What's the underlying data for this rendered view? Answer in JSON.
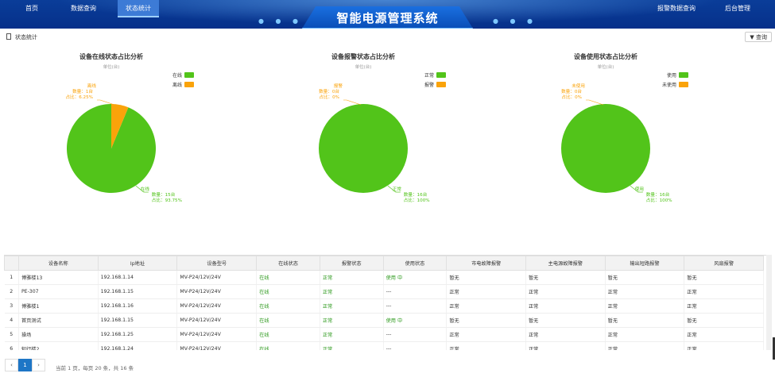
{
  "header": {
    "nav_left": [
      "首页",
      "数据查询",
      "状态统计"
    ],
    "nav_right": [
      "报警数据查询",
      "后台管理"
    ],
    "title": "智能电源管理系统",
    "dots": "● ● ●"
  },
  "subheader": {
    "label": "状态统计",
    "query_button": "▼ 查询"
  },
  "chart_data": [
    {
      "type": "pie",
      "title": "设备在线状态占比分析",
      "subtitle": "单位(台)",
      "legend": [
        "在线",
        "离线"
      ],
      "colors": [
        "#52c41a",
        "#faa30a"
      ],
      "slices": [
        {
          "name": "在线",
          "value": 15,
          "percent": "93.75%",
          "label_lines": [
            "在线",
            "数量：15台",
            "占比：93.75%"
          ]
        },
        {
          "name": "离线",
          "value": 1,
          "percent": "6.25%",
          "label_lines": [
            "离线",
            "数量：1台",
            "占比：6.25%"
          ]
        }
      ]
    },
    {
      "type": "pie",
      "title": "设备报警状态占比分析",
      "subtitle": "单位(台)",
      "legend": [
        "正常",
        "报警"
      ],
      "colors": [
        "#52c41a",
        "#faa30a"
      ],
      "slices": [
        {
          "name": "正常",
          "value": 16,
          "percent": "100%",
          "label_lines": [
            "正常",
            "数量：16台",
            "占比：100%"
          ]
        },
        {
          "name": "报警",
          "value": 0,
          "percent": "0%",
          "label_lines": [
            "报警",
            "数量：0台",
            "占比：0%"
          ]
        }
      ]
    },
    {
      "type": "pie",
      "title": "设备使用状态占比分析",
      "subtitle": "单位(台)",
      "legend": [
        "使用",
        "未使用"
      ],
      "colors": [
        "#52c41a",
        "#faa30a"
      ],
      "slices": [
        {
          "name": "使用",
          "value": 16,
          "percent": "100%",
          "label_lines": [
            "使用",
            "数量：16台",
            "占比：100%"
          ]
        },
        {
          "name": "未使用",
          "value": 0,
          "percent": "0%",
          "label_lines": [
            "未使用",
            "数量：0台",
            "占比：0%"
          ]
        }
      ]
    }
  ],
  "table": {
    "columns": [
      "",
      "设备名称",
      "Ip地址",
      "设备型号",
      "在线状态",
      "报警状态",
      "使用状态",
      "市电故障报警",
      "主电源故障报警",
      "输出短路报警",
      "风扇报警"
    ],
    "rows": [
      [
        "1",
        "博雅楼13",
        "192.168.1.14",
        "MV-P24/12V/24V",
        "在线",
        "正常",
        "使用 中",
        "暂无",
        "暂无",
        "暂无",
        "暂无"
      ],
      [
        "2",
        "PE-307",
        "192.168.1.15",
        "MV-P24/12V/24V",
        "在线",
        "正常",
        "---",
        "正常",
        "正常",
        "正常",
        "正常"
      ],
      [
        "3",
        "博雅楼1",
        "192.168.1.16",
        "MV-P24/12V/24V",
        "在线",
        "正常",
        "---",
        "正常",
        "正常",
        "正常",
        "正常"
      ],
      [
        "4",
        "首页测试",
        "192.168.1.15",
        "MV-P24/12V/24V",
        "在线",
        "正常",
        "使用 中",
        "暂无",
        "暂无",
        "暂无",
        "暂无"
      ],
      [
        "5",
        "操场",
        "192.168.1.25",
        "MV-P24/12V/24V",
        "在线",
        "正常",
        "---",
        "正常",
        "正常",
        "正常",
        "正常"
      ],
      [
        "6",
        "知行楼2",
        "192.168.1.24",
        "MV-P24/12V/24V",
        "在线",
        "正常",
        "---",
        "正常",
        "正常",
        "正常",
        "正常"
      ]
    ]
  },
  "pagination": {
    "prev": "‹",
    "current": "1",
    "next": "›",
    "info": "当前  1  页，每页 20 条，共 16 条"
  }
}
